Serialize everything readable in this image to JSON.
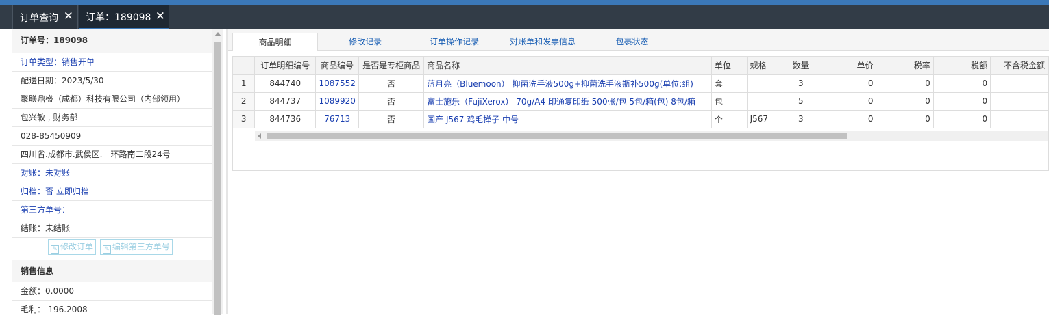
{
  "tabs": [
    {
      "label": "订单查询"
    },
    {
      "label": "订单：189098"
    }
  ],
  "order": {
    "title": "订单号：189098",
    "type": "订单类型：销售开单",
    "date": "配送日期：2023/5/30",
    "company": "聚联鼎盛（成都）科技有限公司（内部领用）",
    "contact": "包兴敏 , 财务部",
    "phone": "028-85450909",
    "address": "四川省.成都市.武侯区.一环路南二段24号",
    "reconcile": "对账：未对账",
    "archive": "归档：否 立即归档",
    "third_party": "第三方单号：",
    "settle": "结账：未结账",
    "edit_order_btn": "修改订单",
    "edit_third_btn": "编辑第三方单号"
  },
  "sales": {
    "title": "销售信息",
    "amount": "金额：0.0000",
    "profit": "毛利：-196.2008"
  },
  "detail_tabs": [
    "商品明细",
    "修改记录",
    "订单操作记录",
    "对账单和发票信息",
    "包裹状态"
  ],
  "table": {
    "headers": [
      "订单明细编号",
      "商品编号",
      "是否是专柜商品",
      "商品名称",
      "单位",
      "规格",
      "数量",
      "单价",
      "税率",
      "税额",
      "不含税金额"
    ],
    "rows": [
      {
        "n": "1",
        "detail_id": "844740",
        "product_id": "1087552",
        "counter": "否",
        "name": "蓝月亮（Bluemoon） 抑菌洗手液500g+抑菌洗手液瓶补500g(单位:组)",
        "unit": "套",
        "spec": "",
        "qty": "3",
        "price": "0",
        "tax_rate": "0",
        "tax": "0"
      },
      {
        "n": "2",
        "detail_id": "844737",
        "product_id": "1089920",
        "counter": "否",
        "name": "富士施乐（FujiXerox） 70g/A4 印通复印纸 500张/包 5包/箱(包) 8包/箱",
        "unit": "包",
        "spec": "",
        "qty": "5",
        "price": "0",
        "tax_rate": "0",
        "tax": "0"
      },
      {
        "n": "3",
        "detail_id": "844736",
        "product_id": "76713",
        "counter": "否",
        "name": "国产 J567 鸡毛掸子 中号",
        "unit": "个",
        "spec": "J567",
        "qty": "3",
        "price": "0",
        "tax_rate": "0",
        "tax": "0"
      }
    ]
  }
}
